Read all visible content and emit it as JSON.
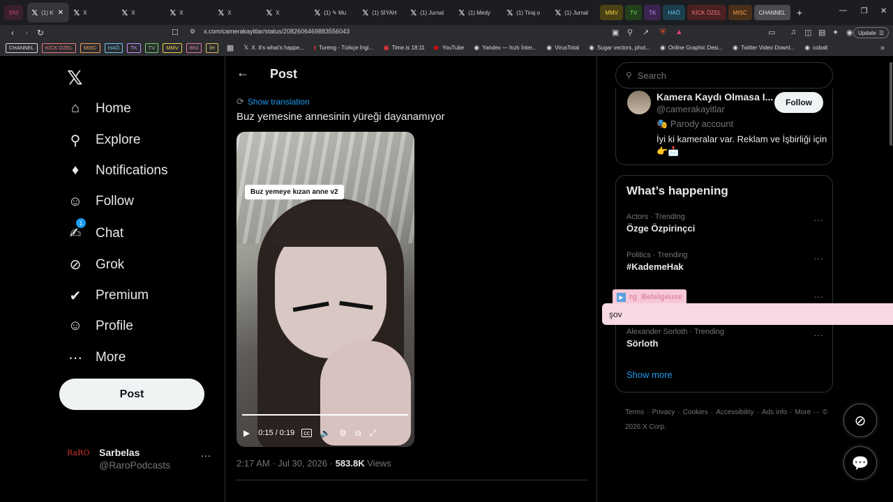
{
  "browser": {
    "tabs": [
      {
        "label": "BNİ",
        "kind": "group",
        "color": "#c04a7a",
        "bg": "#3a1f2c"
      },
      {
        "label": "(1) K",
        "kind": "x",
        "active": true
      },
      {
        "label": "X",
        "kind": "x"
      },
      {
        "label": "X",
        "kind": "x"
      },
      {
        "label": "X",
        "kind": "x"
      },
      {
        "label": "X",
        "kind": "x"
      },
      {
        "label": "X",
        "kind": "x"
      },
      {
        "label": "(1) ✎ Mu",
        "kind": "x"
      },
      {
        "label": "(1) SİYAH",
        "kind": "x"
      },
      {
        "label": "(1) Jurnal",
        "kind": "x"
      },
      {
        "label": "(1) Medy",
        "kind": "x"
      },
      {
        "label": "(1) Tiraj o",
        "kind": "x"
      },
      {
        "label": "(1) Jurnal",
        "kind": "x"
      }
    ],
    "tab_groups": [
      {
        "label": "MMV",
        "color": "#f2d24a",
        "bg": "#4a4214"
      },
      {
        "label": "TV",
        "color": "#7bd46a",
        "bg": "#21401b"
      },
      {
        "label": "TK",
        "color": "#c68ef5",
        "bg": "#3b2550"
      },
      {
        "label": "HAÖ",
        "color": "#6ec8ef",
        "bg": "#1c3e4d"
      },
      {
        "label": "KİCK ÖZEL",
        "color": "#f07b7b",
        "bg": "#4a2020"
      },
      {
        "label": "MISC",
        "color": "#f4a25a",
        "bg": "#4a3018"
      },
      {
        "label": "CHANNEL",
        "color": "#e8e8e8",
        "bg": "#4a4a4f"
      }
    ],
    "new_tab": "+",
    "url": "x.com/camerakayitlar/status/2082606469883556043",
    "update_label": "Update",
    "bookmark_chips": [
      {
        "label": "CHANNEL",
        "color": "#dddddd"
      },
      {
        "label": "KİCK ÖZEL",
        "color": "#f07b7b"
      },
      {
        "label": "MISC",
        "color": "#f4a25a"
      },
      {
        "label": "HAÖ",
        "color": "#6ec8ef"
      },
      {
        "label": "TK",
        "color": "#c68ef5"
      },
      {
        "label": "TV",
        "color": "#7bd46a"
      },
      {
        "label": "MMV",
        "color": "#f2d24a"
      },
      {
        "label": "BNİ",
        "color": "#e07aa8"
      },
      {
        "label": "İH",
        "color": "#e0c060"
      }
    ],
    "bookmark_links": [
      {
        "label": "X. It's what's happe...",
        "icon": "x-icon"
      },
      {
        "label": "Tureng - Türkçe İngi...",
        "icon": "tureng-icon"
      },
      {
        "label": "Time.is 18:11",
        "icon": "clock-icon"
      },
      {
        "label": "YouTube",
        "icon": "youtube-icon"
      },
      {
        "label": "Yandex — hızlı İnter...",
        "icon": "globe-icon"
      },
      {
        "label": "VirusTotal",
        "icon": "globe-icon"
      },
      {
        "label": "Sugar vectors, phot...",
        "icon": "globe-icon"
      },
      {
        "label": "Online Graphic Desi...",
        "icon": "globe-icon"
      },
      {
        "label": "Twitter Video Downl...",
        "icon": "globe-icon"
      },
      {
        "label": "cobalt",
        "icon": "globe-icon"
      }
    ]
  },
  "sidebar": {
    "items": [
      {
        "label": "Home",
        "icon": "home-icon"
      },
      {
        "label": "Explore",
        "icon": "search-icon"
      },
      {
        "label": "Notifications",
        "icon": "bell-icon"
      },
      {
        "label": "Follow",
        "icon": "follow-icon"
      },
      {
        "label": "Chat",
        "icon": "chat-icon",
        "badge": "1"
      },
      {
        "label": "Grok",
        "icon": "grok-icon"
      },
      {
        "label": "Premium",
        "icon": "premium-icon"
      },
      {
        "label": "Profile",
        "icon": "profile-icon"
      },
      {
        "label": "More",
        "icon": "more-icon"
      }
    ],
    "post_label": "Post",
    "account": {
      "name": "Sarbelas",
      "handle": "@RaroPodcasts",
      "avatar_text": "RaRO"
    }
  },
  "main": {
    "header_title": "Post",
    "show_translation": "Show translation",
    "tweet_text": "Buz yemesine annesinin yüreği dayanamıyor",
    "video": {
      "caption": "Buz yemeye kızan anne v2",
      "time": "0:15 / 0:19",
      "progress": 1.0
    },
    "meta": {
      "time": "2:17 AM",
      "date": "Jul 30, 2026",
      "views_count": "583.8K",
      "views_label": "Views"
    }
  },
  "right": {
    "search_placeholder": "Search",
    "profile": {
      "name": "Kamera Kaydı Olmasa I...",
      "handle": "@camerakayitlar",
      "parody": "Parody account",
      "bio": "İyi ki kameralar var. Reklam ve İşbirliği için 👉📩",
      "follow_label": "Follow"
    },
    "trends_title": "What’s happening",
    "trends": [
      {
        "category": "Actors · Trending",
        "name": "Özge Özpirinçci"
      },
      {
        "category": "Politics · Trending",
        "name": "#KademeHak"
      },
      {
        "category": "",
        "name": ""
      },
      {
        "category": "Alexander Sorloth · Trending",
        "name": "Sörloth"
      }
    ],
    "show_more": "Show more",
    "footer": [
      "Terms",
      "·",
      "Privacy",
      "·",
      "Cookies",
      "·",
      "Accessibility",
      "·",
      "Ads info",
      "·",
      "More ···",
      "© 2026 X Corp."
    ]
  },
  "overlay": {
    "username": "rg_Betelgeuse",
    "message": "şov"
  }
}
